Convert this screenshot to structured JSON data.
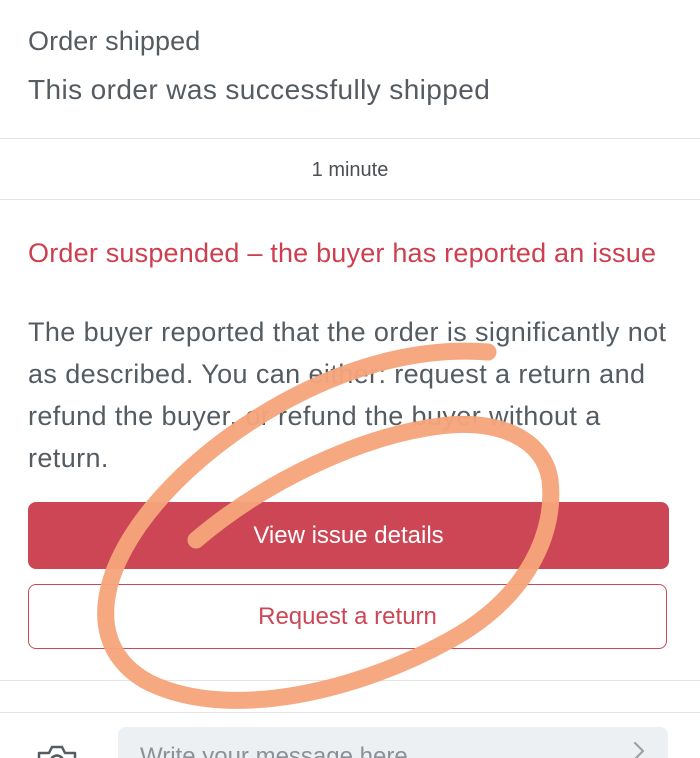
{
  "timeline": {
    "shipped": {
      "title": "Order shipped",
      "body": "This order was successfully shipped"
    },
    "timestamp": "1 minute",
    "issue": {
      "title": "Order suspended – the buyer has reported an issue",
      "body": "The buyer reported that the order is significantly not as described. You can either: request a return and refund the buyer, or refund the buyer without a return.",
      "view_details_label": "View issue details",
      "request_return_label": "Request a return"
    }
  },
  "composer": {
    "camera_icon": "camera-icon",
    "placeholder": "Write your message here",
    "send_icon": "chevron-right-icon"
  },
  "colors": {
    "accent": "#cd4656",
    "alert_text": "#cd3f4f",
    "body_text": "#545b61",
    "divider": "#e3e3e3",
    "annotation": "#f6a47c"
  }
}
